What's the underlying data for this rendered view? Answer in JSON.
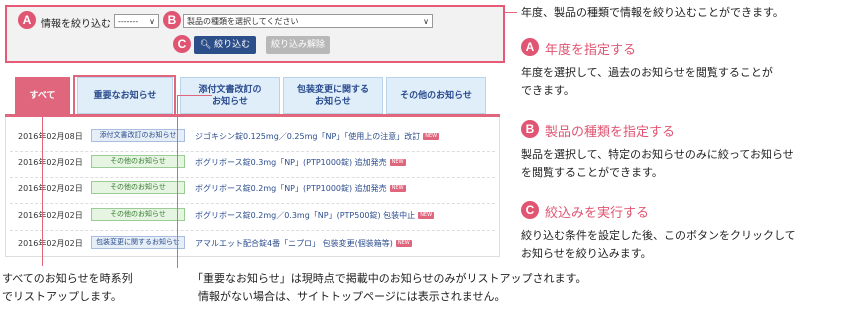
{
  "filter": {
    "label": "情報を絞り込む",
    "year_select": "-------",
    "product_select": "製品の種類を選択してください",
    "narrow_button": "絞り込む",
    "reset_button": "絞り込み解除",
    "marker_a": "A",
    "marker_b": "B",
    "marker_c": "C"
  },
  "tabs": [
    {
      "label": "すべて"
    },
    {
      "label": "重要なお知らせ"
    },
    {
      "label": "添付文書改訂の\nお知らせ"
    },
    {
      "label": "包装変更に関する\nお知らせ"
    },
    {
      "label": "その他のお知らせ"
    }
  ],
  "news": [
    {
      "date": "2016年02月08日",
      "category": "添付文書改訂のお知らせ",
      "title": "ジゴキシン錠0.125mg／0.25mg「NP」「使用上の注意」改訂",
      "new": "NEW"
    },
    {
      "date": "2016年02月02日",
      "category": "その他のお知らせ",
      "title": "ボグリボース錠0.3mg「NP」(PTP1000錠) 追加発売",
      "new": "NEW"
    },
    {
      "date": "2016年02月02日",
      "category": "その他のお知らせ",
      "title": "ボグリボース錠0.2mg「NP」(PTP1000錠) 追加発売",
      "new": "NEW"
    },
    {
      "date": "2016年02月02日",
      "category": "その他のお知らせ",
      "title": "ボグリボース錠0.2mg／0.3mg「NP」(PTP500錠) 包装中止",
      "new": "NEW"
    },
    {
      "date": "2016年02月02日",
      "category": "包装変更に関するお知らせ",
      "title": "アマルエット配合錠4番「ニプロ」 包装変更(個装箱等)",
      "new": "NEW"
    }
  ],
  "explain": {
    "top_note": "年度、製品の種類で情報を絞り込むことができます。",
    "a_marker": "A",
    "a_head": "年度を指定する",
    "a_text1": "年度を選択して、過去のお知らせを閲覧することが",
    "a_text2": "できます。",
    "b_marker": "B",
    "b_head": "製品の種類を指定する",
    "b_text1": "製品を選択して、特定のお知らせのみに絞ってお知らせ",
    "b_text2": "を閲覧することができます。",
    "c_marker": "C",
    "c_head": "絞込みを実行する",
    "c_text1": "絞り込む条件を設定した後、このボタンをクリックして",
    "c_text2": "お知らせを絞り込みます。"
  },
  "captions": {
    "left1": "すべてのお知らせを時系列",
    "left2": "でリストアップします。",
    "bottom1": "「重要なお知らせ」は現時点で掲載中のお知らせのみがリストアップされます。",
    "bottom2": "情報がない場合は、サイトトップページには表示されません。"
  },
  "colors": {
    "accent": "#e0667e",
    "button": "#2c4f8a"
  }
}
